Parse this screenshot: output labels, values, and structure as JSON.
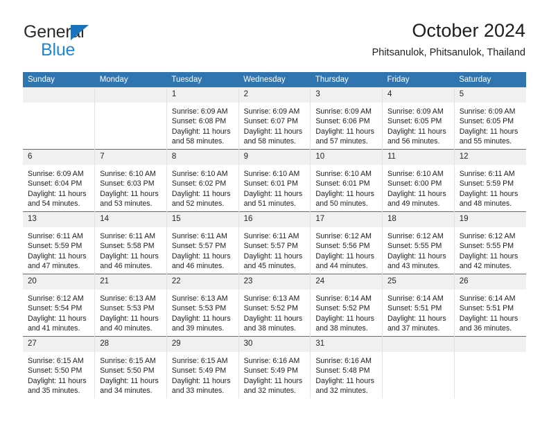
{
  "brand": {
    "name_top": "General",
    "name_bottom": "Blue",
    "accent_color": "#1b74bb",
    "text_color": "#2b2b2b"
  },
  "header": {
    "title": "October 2024",
    "subtitle": "Phitsanulok, Phitsanulok, Thailand"
  },
  "theme": {
    "header_blue": "#3175b0",
    "daynum_band": "#f0f0f0",
    "cell_divider": "#e3e3e3"
  },
  "calendar": {
    "weekday_headers": [
      "Sunday",
      "Monday",
      "Tuesday",
      "Wednesday",
      "Thursday",
      "Friday",
      "Saturday"
    ],
    "weeks": [
      [
        {
          "day": "",
          "detail": ""
        },
        {
          "day": "",
          "detail": ""
        },
        {
          "day": "1",
          "detail": "Sunrise: 6:09 AM\nSunset: 6:08 PM\nDaylight: 11 hours\nand 58 minutes."
        },
        {
          "day": "2",
          "detail": "Sunrise: 6:09 AM\nSunset: 6:07 PM\nDaylight: 11 hours\nand 58 minutes."
        },
        {
          "day": "3",
          "detail": "Sunrise: 6:09 AM\nSunset: 6:06 PM\nDaylight: 11 hours\nand 57 minutes."
        },
        {
          "day": "4",
          "detail": "Sunrise: 6:09 AM\nSunset: 6:05 PM\nDaylight: 11 hours\nand 56 minutes."
        },
        {
          "day": "5",
          "detail": "Sunrise: 6:09 AM\nSunset: 6:05 PM\nDaylight: 11 hours\nand 55 minutes."
        }
      ],
      [
        {
          "day": "6",
          "detail": "Sunrise: 6:09 AM\nSunset: 6:04 PM\nDaylight: 11 hours\nand 54 minutes."
        },
        {
          "day": "7",
          "detail": "Sunrise: 6:10 AM\nSunset: 6:03 PM\nDaylight: 11 hours\nand 53 minutes."
        },
        {
          "day": "8",
          "detail": "Sunrise: 6:10 AM\nSunset: 6:02 PM\nDaylight: 11 hours\nand 52 minutes."
        },
        {
          "day": "9",
          "detail": "Sunrise: 6:10 AM\nSunset: 6:01 PM\nDaylight: 11 hours\nand 51 minutes."
        },
        {
          "day": "10",
          "detail": "Sunrise: 6:10 AM\nSunset: 6:01 PM\nDaylight: 11 hours\nand 50 minutes."
        },
        {
          "day": "11",
          "detail": "Sunrise: 6:10 AM\nSunset: 6:00 PM\nDaylight: 11 hours\nand 49 minutes."
        },
        {
          "day": "12",
          "detail": "Sunrise: 6:11 AM\nSunset: 5:59 PM\nDaylight: 11 hours\nand 48 minutes."
        }
      ],
      [
        {
          "day": "13",
          "detail": "Sunrise: 6:11 AM\nSunset: 5:59 PM\nDaylight: 11 hours\nand 47 minutes."
        },
        {
          "day": "14",
          "detail": "Sunrise: 6:11 AM\nSunset: 5:58 PM\nDaylight: 11 hours\nand 46 minutes."
        },
        {
          "day": "15",
          "detail": "Sunrise: 6:11 AM\nSunset: 5:57 PM\nDaylight: 11 hours\nand 46 minutes."
        },
        {
          "day": "16",
          "detail": "Sunrise: 6:11 AM\nSunset: 5:57 PM\nDaylight: 11 hours\nand 45 minutes."
        },
        {
          "day": "17",
          "detail": "Sunrise: 6:12 AM\nSunset: 5:56 PM\nDaylight: 11 hours\nand 44 minutes."
        },
        {
          "day": "18",
          "detail": "Sunrise: 6:12 AM\nSunset: 5:55 PM\nDaylight: 11 hours\nand 43 minutes."
        },
        {
          "day": "19",
          "detail": "Sunrise: 6:12 AM\nSunset: 5:55 PM\nDaylight: 11 hours\nand 42 minutes."
        }
      ],
      [
        {
          "day": "20",
          "detail": "Sunrise: 6:12 AM\nSunset: 5:54 PM\nDaylight: 11 hours\nand 41 minutes."
        },
        {
          "day": "21",
          "detail": "Sunrise: 6:13 AM\nSunset: 5:53 PM\nDaylight: 11 hours\nand 40 minutes."
        },
        {
          "day": "22",
          "detail": "Sunrise: 6:13 AM\nSunset: 5:53 PM\nDaylight: 11 hours\nand 39 minutes."
        },
        {
          "day": "23",
          "detail": "Sunrise: 6:13 AM\nSunset: 5:52 PM\nDaylight: 11 hours\nand 38 minutes."
        },
        {
          "day": "24",
          "detail": "Sunrise: 6:14 AM\nSunset: 5:52 PM\nDaylight: 11 hours\nand 38 minutes."
        },
        {
          "day": "25",
          "detail": "Sunrise: 6:14 AM\nSunset: 5:51 PM\nDaylight: 11 hours\nand 37 minutes."
        },
        {
          "day": "26",
          "detail": "Sunrise: 6:14 AM\nSunset: 5:51 PM\nDaylight: 11 hours\nand 36 minutes."
        }
      ],
      [
        {
          "day": "27",
          "detail": "Sunrise: 6:15 AM\nSunset: 5:50 PM\nDaylight: 11 hours\nand 35 minutes."
        },
        {
          "day": "28",
          "detail": "Sunrise: 6:15 AM\nSunset: 5:50 PM\nDaylight: 11 hours\nand 34 minutes."
        },
        {
          "day": "29",
          "detail": "Sunrise: 6:15 AM\nSunset: 5:49 PM\nDaylight: 11 hours\nand 33 minutes."
        },
        {
          "day": "30",
          "detail": "Sunrise: 6:16 AM\nSunset: 5:49 PM\nDaylight: 11 hours\nand 32 minutes."
        },
        {
          "day": "31",
          "detail": "Sunrise: 6:16 AM\nSunset: 5:48 PM\nDaylight: 11 hours\nand 32 minutes."
        },
        {
          "day": "",
          "detail": ""
        },
        {
          "day": "",
          "detail": ""
        }
      ]
    ]
  }
}
